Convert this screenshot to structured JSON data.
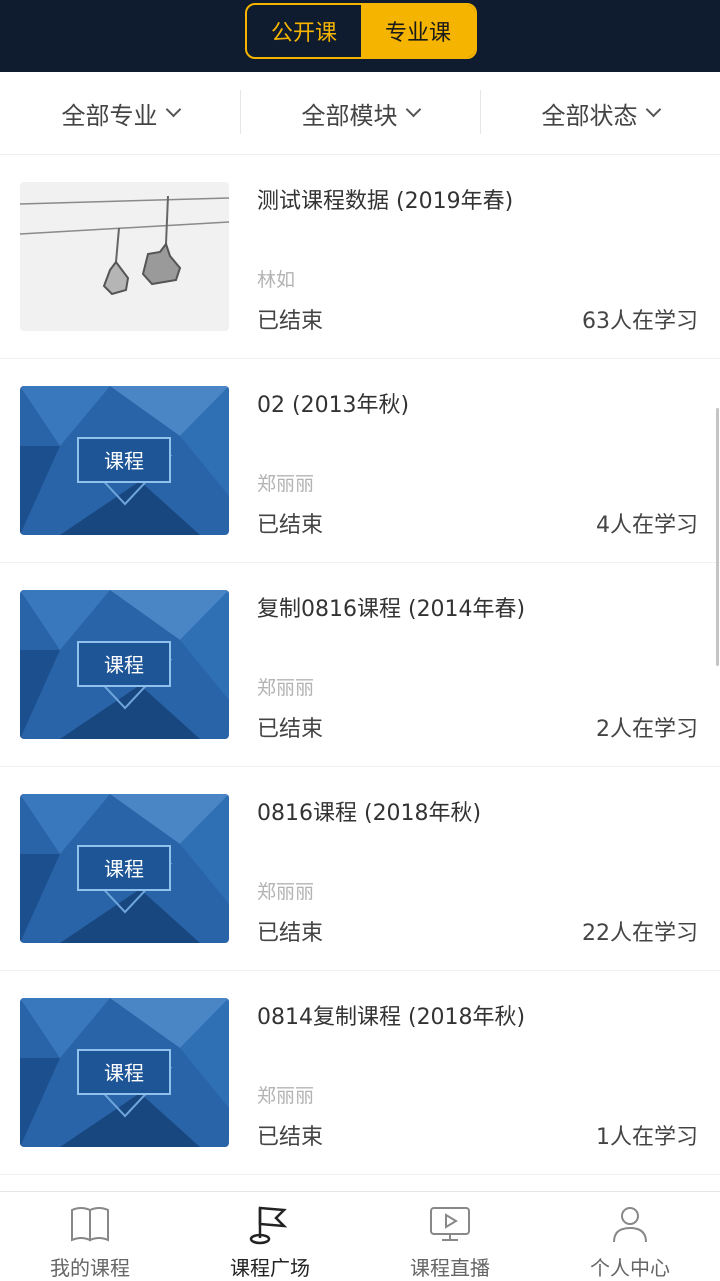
{
  "header": {
    "segments": [
      {
        "label": "公开课",
        "active": false
      },
      {
        "label": "专业课",
        "active": true
      }
    ]
  },
  "filters": [
    {
      "label": "全部专业"
    },
    {
      "label": "全部模块"
    },
    {
      "label": "全部状态"
    }
  ],
  "courses": [
    {
      "title": "测试课程数据 (2019年春)",
      "teacher": "林如",
      "status": "已结束",
      "learners": "63人在学习",
      "thumb": "chairlift-photo"
    },
    {
      "title": "02 (2013年秋)",
      "teacher": "郑丽丽",
      "status": "已结束",
      "learners": "4人在学习",
      "thumb": "course-cover",
      "thumb_text": "课程"
    },
    {
      "title": "复制0816课程 (2014年春)",
      "teacher": "郑丽丽",
      "status": "已结束",
      "learners": "2人在学习",
      "thumb": "course-cover",
      "thumb_text": "课程"
    },
    {
      "title": "0816课程 (2018年秋)",
      "teacher": "郑丽丽",
      "status": "已结束",
      "learners": "22人在学习",
      "thumb": "course-cover",
      "thumb_text": "课程"
    },
    {
      "title": "0814复制课程 (2018年秋)",
      "teacher": "郑丽丽",
      "status": "已结束",
      "learners": "1人在学习",
      "thumb": "course-cover",
      "thumb_text": "课程"
    }
  ],
  "tabbar": [
    {
      "label": "我的课程",
      "icon": "book-icon",
      "active": false
    },
    {
      "label": "课程广场",
      "icon": "flag-icon",
      "active": true
    },
    {
      "label": "课程直播",
      "icon": "live-screen-icon",
      "active": false
    },
    {
      "label": "个人中心",
      "icon": "user-icon",
      "active": false
    }
  ],
  "colors": {
    "header_bg": "#0f1b2e",
    "accent": "#f5b400",
    "cover_blue": "#1f5fa8"
  }
}
